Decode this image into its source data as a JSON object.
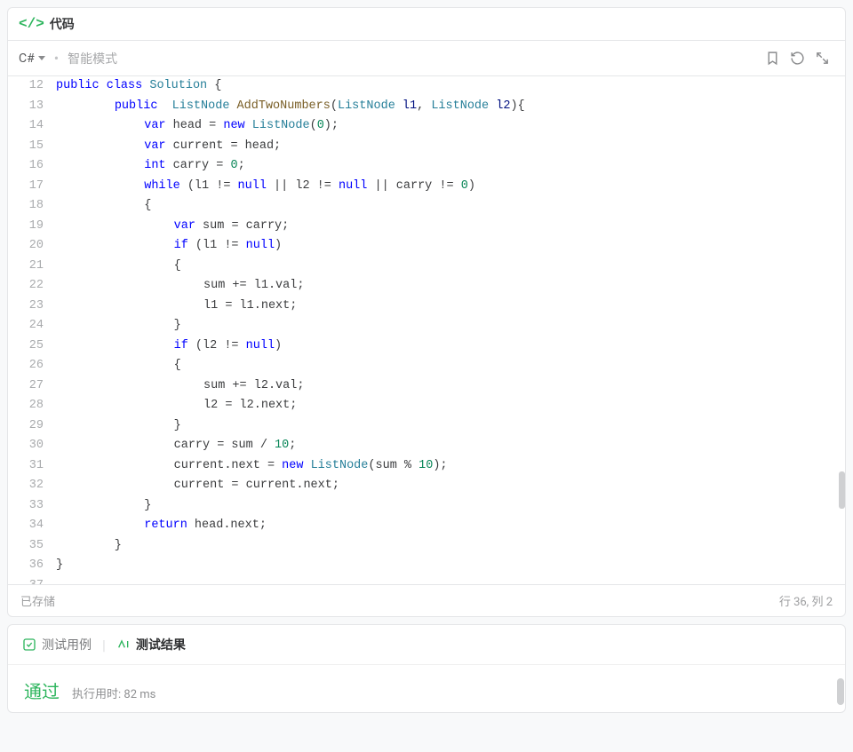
{
  "header": {
    "title": "代码"
  },
  "toolbar": {
    "language": "C#",
    "mode": "智能模式",
    "icons": {
      "bookmark": "bookmark-icon",
      "reset": "reset-icon",
      "fullscreen": "fullscreen-icon"
    }
  },
  "editor": {
    "first_line_number": 12,
    "lines": [
      [
        [
          "kw",
          "public"
        ],
        [
          "",
          " "
        ],
        [
          "kw",
          "class"
        ],
        [
          "",
          " "
        ],
        [
          "cls",
          "Solution"
        ],
        [
          "",
          " {"
        ]
      ],
      [
        [
          "",
          "        "
        ],
        [
          "kw",
          "public"
        ],
        [
          "",
          "  "
        ],
        [
          "cls",
          "ListNode"
        ],
        [
          "",
          " "
        ],
        [
          "fn",
          "AddTwoNumbers"
        ],
        [
          "",
          "("
        ],
        [
          "cls",
          "ListNode"
        ],
        [
          "",
          " "
        ],
        [
          "prm",
          "l1"
        ],
        [
          "",
          ", "
        ],
        [
          "cls",
          "ListNode"
        ],
        [
          "",
          " "
        ],
        [
          "prm",
          "l2"
        ],
        [
          "",
          "){"
        ]
      ],
      [
        [
          "",
          "            "
        ],
        [
          "kw",
          "var"
        ],
        [
          "",
          " head = "
        ],
        [
          "kw",
          "new"
        ],
        [
          "",
          " "
        ],
        [
          "cls",
          "ListNode"
        ],
        [
          "",
          "("
        ],
        [
          "num",
          "0"
        ],
        [
          "",
          ");"
        ]
      ],
      [
        [
          "",
          "            "
        ],
        [
          "kw",
          "var"
        ],
        [
          "",
          " current = head;"
        ]
      ],
      [
        [
          "",
          "            "
        ],
        [
          "kw",
          "int"
        ],
        [
          "",
          " carry = "
        ],
        [
          "num",
          "0"
        ],
        [
          "",
          ";"
        ]
      ],
      [
        [
          "",
          "            "
        ],
        [
          "kw",
          "while"
        ],
        [
          "",
          " (l1 != "
        ],
        [
          "kw",
          "null"
        ],
        [
          "",
          " || l2 != "
        ],
        [
          "kw",
          "null"
        ],
        [
          "",
          " || carry != "
        ],
        [
          "num",
          "0"
        ],
        [
          "",
          ")"
        ]
      ],
      [
        [
          "",
          "            {"
        ]
      ],
      [
        [
          "",
          "                "
        ],
        [
          "kw",
          "var"
        ],
        [
          "",
          " sum = carry;"
        ]
      ],
      [
        [
          "",
          "                "
        ],
        [
          "kw",
          "if"
        ],
        [
          "",
          " (l1 != "
        ],
        [
          "kw",
          "null"
        ],
        [
          "",
          ")"
        ]
      ],
      [
        [
          "",
          "                {"
        ]
      ],
      [
        [
          "",
          "                    sum += l1.val;"
        ]
      ],
      [
        [
          "",
          "                    l1 = l1.next;"
        ]
      ],
      [
        [
          "",
          "                }"
        ]
      ],
      [
        [
          "",
          "                "
        ],
        [
          "kw",
          "if"
        ],
        [
          "",
          " (l2 != "
        ],
        [
          "kw",
          "null"
        ],
        [
          "",
          ")"
        ]
      ],
      [
        [
          "",
          "                {"
        ]
      ],
      [
        [
          "",
          "                    sum += l2.val;"
        ]
      ],
      [
        [
          "",
          "                    l2 = l2.next;"
        ]
      ],
      [
        [
          "",
          "                }"
        ]
      ],
      [
        [
          "",
          "                carry = sum / "
        ],
        [
          "num",
          "10"
        ],
        [
          "",
          ";"
        ]
      ],
      [
        [
          "",
          "                current.next = "
        ],
        [
          "kw",
          "new"
        ],
        [
          "",
          " "
        ],
        [
          "cls",
          "ListNode"
        ],
        [
          "",
          "(sum % "
        ],
        [
          "num",
          "10"
        ],
        [
          "",
          ");"
        ]
      ],
      [
        [
          "",
          "                current = current.next;"
        ]
      ],
      [
        [
          "",
          "            }"
        ]
      ],
      [
        [
          "",
          "            "
        ],
        [
          "kw",
          "return"
        ],
        [
          "",
          " head.next;"
        ]
      ],
      [
        [
          "",
          "        }"
        ]
      ],
      [
        [
          "",
          "}"
        ]
      ],
      [
        [
          "",
          ""
        ]
      ]
    ]
  },
  "status": {
    "saved": "已存储",
    "cursor": "行 36,  列 2"
  },
  "results": {
    "tab_testcases": "测试用例",
    "tab_results": "测试结果",
    "pass": "通过",
    "exec_label": "执行用时:",
    "exec_value": "82 ms"
  }
}
